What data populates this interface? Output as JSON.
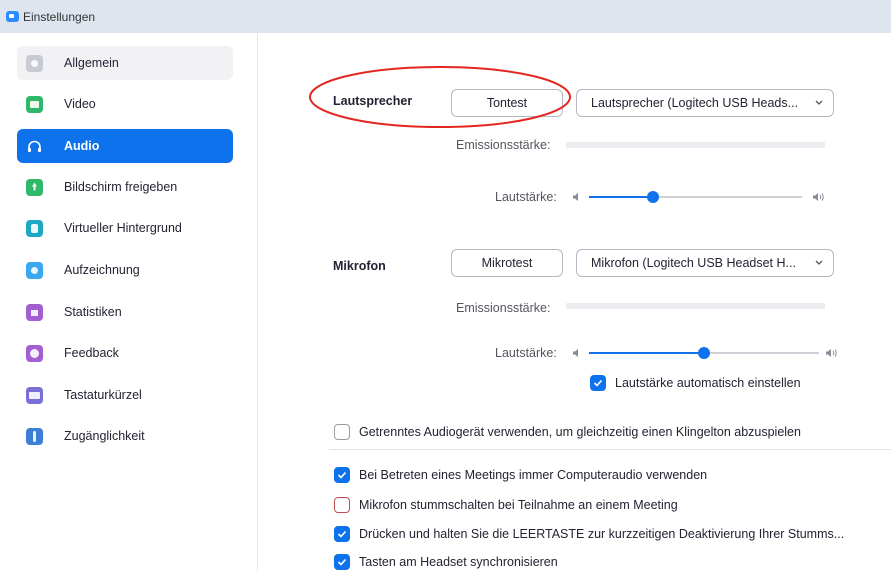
{
  "window": {
    "title": "Einstellungen"
  },
  "sidebar": {
    "items": [
      {
        "label": "Allgemein",
        "icon": "gear-icon",
        "color": "#c9cbd4",
        "state": "hover"
      },
      {
        "label": "Video",
        "icon": "video-camera-icon",
        "color": "#2fb86a",
        "state": "normal"
      },
      {
        "label": "Audio",
        "icon": "headphones-icon",
        "color": "#0e72ed",
        "state": "active"
      },
      {
        "label": "Bildschirm freigeben",
        "icon": "share-screen-icon",
        "color": "#2fb86a",
        "state": "normal"
      },
      {
        "label": "Virtueller Hintergrund",
        "icon": "virtual-background-icon",
        "color": "#1fa8c4",
        "state": "normal"
      },
      {
        "label": "Aufzeichnung",
        "icon": "record-icon",
        "color": "#3aa7f0",
        "state": "normal"
      },
      {
        "label": "Statistiken",
        "icon": "statistics-icon",
        "color": "#a35fd1",
        "state": "normal"
      },
      {
        "label": "Feedback",
        "icon": "feedback-smiley-icon",
        "color": "#a35fd1",
        "state": "normal"
      },
      {
        "label": "Tastaturkürzel",
        "icon": "keyboard-icon",
        "color": "#7a6fd6",
        "state": "normal"
      },
      {
        "label": "Zugänglichkeit",
        "icon": "accessibility-icon",
        "color": "#3d7fd6",
        "state": "normal"
      }
    ]
  },
  "speaker": {
    "label": "Lautsprecher",
    "test_button": "Tontest",
    "device": "Lautsprecher (Logitech USB Heads...",
    "emission_label": "Emissionsstärke:",
    "volume_label": "Lautstärke:",
    "volume_level": 0.3
  },
  "microphone": {
    "label": "Mikrofon",
    "test_button": "Mikrotest",
    "device": "Mikrofon (Logitech USB Headset H...",
    "emission_label": "Emissionsstärke:",
    "volume_label": "Lautstärke:",
    "volume_level": 0.5,
    "auto_volume": {
      "label": "Lautstärke automatisch einstellen",
      "checked": true
    }
  },
  "options": [
    {
      "label": "Getrenntes Audiogerät verwenden, um gleichzeitig einen Klingelton abzuspielen",
      "checked": false
    },
    {
      "label": "Bei Betreten eines Meetings immer Computeraudio verwenden",
      "checked": true
    },
    {
      "label": "Mikrofon stummschalten bei Teilnahme an einem Meeting",
      "checked": false
    },
    {
      "label": "Drücken und halten Sie die LEERTASTE zur kurzzeitigen Deaktivierung Ihrer Stumms...",
      "checked": true
    },
    {
      "label": "Tasten am Headset synchronisieren",
      "checked": true
    }
  ],
  "colors": {
    "accent": "#0e72ed",
    "annotation": "#e3261f"
  }
}
